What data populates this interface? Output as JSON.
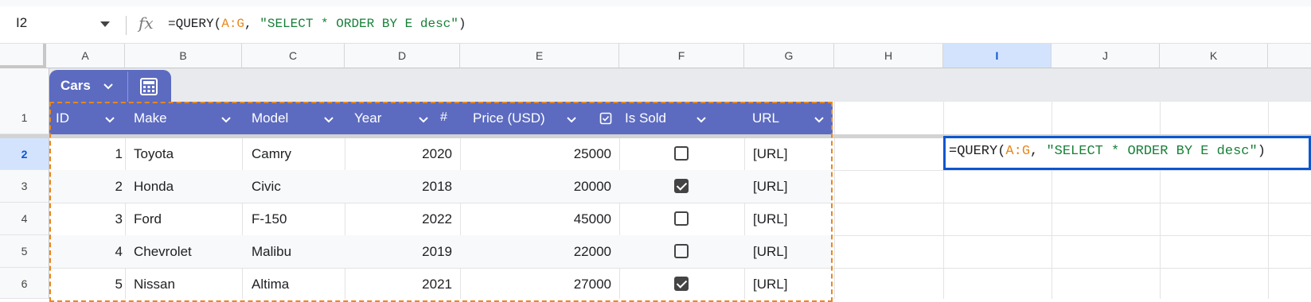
{
  "formula_bar": {
    "name_box": "I2",
    "fx_label": "fx",
    "formula_prefix": "=QUERY(",
    "formula_ref": "A:G",
    "formula_mid": ", ",
    "formula_string": "\"SELECT * ORDER BY E desc\"",
    "formula_suffix": ")"
  },
  "columns": [
    "A",
    "B",
    "C",
    "D",
    "E",
    "F",
    "G",
    "H",
    "I",
    "J",
    "K"
  ],
  "selected_column": "I",
  "rows": [
    "1",
    "2",
    "3",
    "4",
    "5",
    "6"
  ],
  "selected_row": "2",
  "table": {
    "name": "Cars",
    "headers": [
      "ID",
      "Make",
      "Model",
      "Year",
      "Price (USD)",
      "Is Sold",
      "URL"
    ],
    "header_color": "#5c6bc0",
    "data": [
      {
        "id": "1",
        "make": "Toyota",
        "model": "Camry",
        "year": "2020",
        "price": "25000",
        "sold": false,
        "url": "[URL]"
      },
      {
        "id": "2",
        "make": "Honda",
        "model": "Civic",
        "year": "2018",
        "price": "20000",
        "sold": true,
        "url": "[URL]"
      },
      {
        "id": "3",
        "make": "Ford",
        "model": "F-150",
        "year": "2022",
        "price": "45000",
        "sold": false,
        "url": "[URL]"
      },
      {
        "id": "4",
        "make": "Chevrolet",
        "model": "Malibu",
        "year": "2019",
        "price": "22000",
        "sold": false,
        "url": "[URL]"
      },
      {
        "id": "5",
        "make": "Nissan",
        "model": "Altima",
        "year": "2021",
        "price": "27000",
        "sold": true,
        "url": "[URL]"
      }
    ]
  },
  "colors": {
    "selection_blue": "#0b57d0",
    "copy_outline_orange": "#e8871e",
    "formula_string_green": "#188038"
  }
}
